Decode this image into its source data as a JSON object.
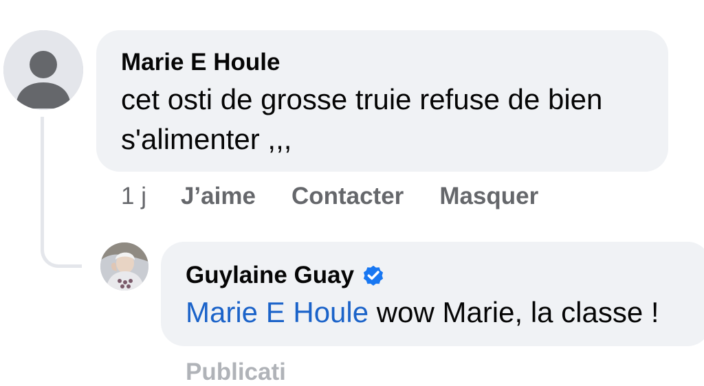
{
  "comments": [
    {
      "author": "Marie E Houle",
      "text": "cet osti de grosse truie refuse de bien s'alimenter ,,,",
      "time": "1 j",
      "actions": [
        "J’aime",
        "Contacter",
        "Masquer"
      ]
    },
    {
      "author": "Guylaine Guay",
      "verified": true,
      "mention": "Marie E Houle",
      "text": " wow Marie, la classe !"
    }
  ],
  "footer_partial_label": "Publicati",
  "colors": {
    "bubble": "#f0f2f5",
    "meta": "#65676b",
    "mention": "#1b63c9",
    "verified": "#1877f2"
  },
  "icons": {
    "default_avatar": "person-silhouette-icon",
    "verified_badge": "verified-badge-icon"
  }
}
